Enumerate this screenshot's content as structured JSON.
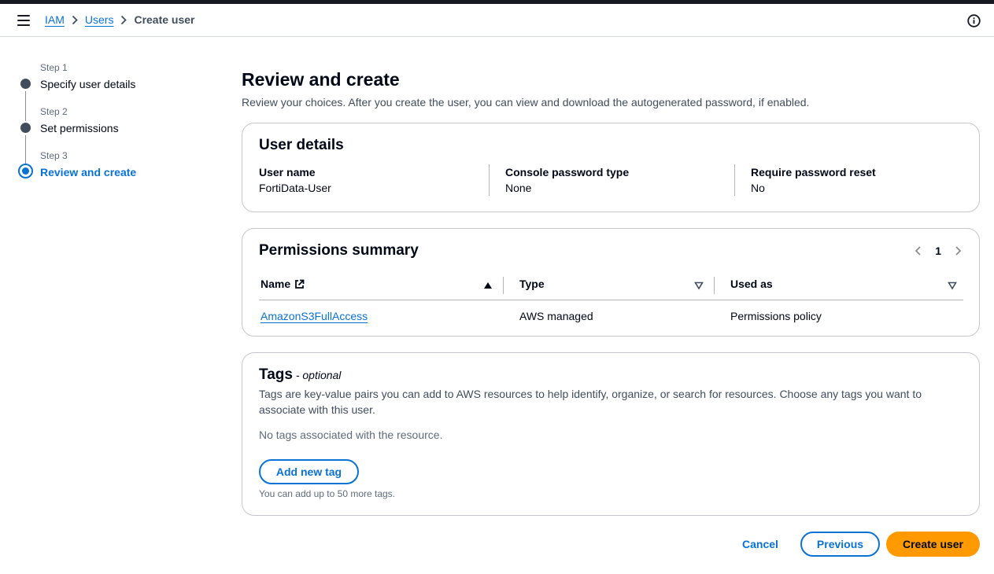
{
  "breadcrumb": {
    "items": [
      {
        "label": "IAM"
      },
      {
        "label": "Users"
      }
    ],
    "current": "Create user"
  },
  "steps": [
    {
      "number": "Step 1",
      "label": "Specify user details"
    },
    {
      "number": "Step 2",
      "label": "Set permissions"
    },
    {
      "number": "Step 3",
      "label": "Review and create"
    }
  ],
  "page": {
    "title": "Review and create",
    "description": "Review your choices. After you create the user, you can view and download the autogenerated password, if enabled."
  },
  "user_details": {
    "title": "User details",
    "fields": [
      {
        "key": "User name",
        "value": "FortiData-User"
      },
      {
        "key": "Console password type",
        "value": "None"
      },
      {
        "key": "Require password reset",
        "value": "No"
      }
    ]
  },
  "permissions": {
    "title": "Permissions summary",
    "page": "1",
    "columns": [
      "Name",
      "Type",
      "Used as"
    ],
    "rows": [
      {
        "name": "AmazonS3FullAccess",
        "type": "AWS managed",
        "used_as": "Permissions policy"
      }
    ]
  },
  "tags": {
    "title": "Tags",
    "optional": " - optional",
    "description": "Tags are key-value pairs you can add to AWS resources to help identify, organize, or search for resources. Choose any tags you want to associate with this user.",
    "empty": "No tags associated with the resource.",
    "add_button": "Add new tag",
    "hint": "You can add up to 50 more tags."
  },
  "actions": {
    "cancel": "Cancel",
    "previous": "Previous",
    "create": "Create user"
  },
  "colors": {
    "link": "#0972d3",
    "primary_button": "#ff9900",
    "border": "#c6c6cd"
  }
}
